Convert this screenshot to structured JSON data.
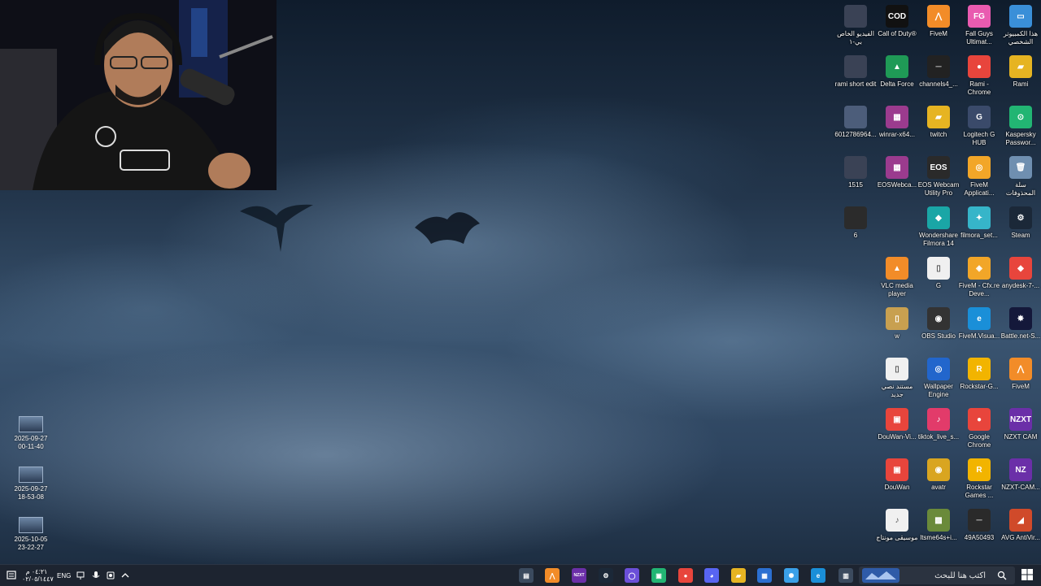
{
  "desktop": {
    "icons": [
      {
        "label": "الفيديو الخاص بي-١",
        "color": "#3a4255",
        "glyph": ""
      },
      {
        "label": "Call of Duty®",
        "color": "#111111",
        "glyph": "COD"
      },
      {
        "label": "FiveM",
        "color": "#f28c28",
        "glyph": "⋀"
      },
      {
        "label": "Fall Guys Ultimat...",
        "color": "#e95bb0",
        "glyph": "FG"
      },
      {
        "label": "هذا الكمبيوتر الشخصي",
        "color": "#3a8fd8",
        "glyph": "▭"
      },
      {
        "label": "rami short edit",
        "color": "#3a4255",
        "glyph": ""
      },
      {
        "label": "Delta Force",
        "color": "#1f9a56",
        "glyph": "▲"
      },
      {
        "label": "channels4_...",
        "color": "#222222",
        "glyph": "─"
      },
      {
        "label": "Rami - Chrome",
        "color": "#e8453c",
        "glyph": "●"
      },
      {
        "label": "Rami",
        "color": "#e6b422",
        "glyph": "▰"
      },
      {
        "label": "6012786964...",
        "color": "#4c5d7a",
        "glyph": ""
      },
      {
        "label": "winrar-x64...",
        "color": "#9b3b8e",
        "glyph": "▦"
      },
      {
        "label": "twitch",
        "color": "#e6b422",
        "glyph": "▰"
      },
      {
        "label": "Logitech G HUB",
        "color": "#3a4a6a",
        "glyph": "G"
      },
      {
        "label": "Kaspersky Passwor...",
        "color": "#22b573",
        "glyph": "⊙"
      },
      {
        "label": "1515",
        "color": "#3a4255",
        "glyph": ""
      },
      {
        "label": "EOSWebca...",
        "color": "#9b3b8e",
        "glyph": "▦"
      },
      {
        "label": "EOS Webcam Utility Pro",
        "color": "#2a2a2a",
        "glyph": "EOS"
      },
      {
        "label": "FiveM Applicati...",
        "color": "#f2a628",
        "glyph": "◎"
      },
      {
        "label": "سلة المحذوفات",
        "color": "#6f8fb0",
        "glyph": "🗑"
      },
      {
        "label": "6",
        "color": "#2b2b2b",
        "glyph": ""
      },
      {
        "label": "Wondershare Filmora 14",
        "color": "#1aa6a6",
        "glyph": "◆"
      },
      {
        "label": "filmora_set...",
        "color": "#36b5c9",
        "glyph": "✦"
      },
      {
        "label": "Steam",
        "color": "#1b2838",
        "glyph": "⚙"
      },
      {
        "label": "VLC media player",
        "color": "#f28c28",
        "glyph": "▲"
      },
      {
        "label": "G",
        "color": "#f0f0f0",
        "glyph": "▯"
      },
      {
        "label": "FiveM - Cfx.re Deve...",
        "color": "#f2a628",
        "glyph": "◈"
      },
      {
        "label": "anydesk-7-...",
        "color": "#e8453c",
        "glyph": "◆"
      },
      {
        "label": "w",
        "color": "#c8a050",
        "glyph": "▯"
      },
      {
        "label": "OBS Studio",
        "color": "#333333",
        "glyph": "◉"
      },
      {
        "label": "FiveM.Visua...",
        "color": "#1a8fd8",
        "glyph": "e"
      },
      {
        "label": "Battle.net-S...",
        "color": "#14183a",
        "glyph": "✸"
      },
      {
        "label": "مستند نصي جديد",
        "color": "#f0f0f0",
        "glyph": "▯"
      },
      {
        "label": "Wallpaper Engine",
        "color": "#2266cc",
        "glyph": "◎"
      },
      {
        "label": "Rockstar-G...",
        "color": "#f2b400",
        "glyph": "R"
      },
      {
        "label": "FiveM",
        "color": "#f28c28",
        "glyph": "⋀"
      },
      {
        "label": "DouWan-Vi...",
        "color": "#e8453c",
        "glyph": "▣"
      },
      {
        "label": "tiktok_live_s...",
        "color": "#e23b6a",
        "glyph": "♪"
      },
      {
        "label": "Google Chrome",
        "color": "#e8453c",
        "glyph": "●"
      },
      {
        "label": "NZXT CAM",
        "color": "#6b2fa8",
        "glyph": "NZXT"
      },
      {
        "label": "DouWan",
        "color": "#e8453c",
        "glyph": "▣"
      },
      {
        "label": "avatr",
        "color": "#d9a520",
        "glyph": "◉"
      },
      {
        "label": "Rockstar Games ...",
        "color": "#f2b400",
        "glyph": "R"
      },
      {
        "label": "NZXT-CAM...",
        "color": "#6b2fa8",
        "glyph": "NZ"
      },
      {
        "label": "موسيقى مونتاج",
        "color": "#f0f0f0",
        "glyph": "♪"
      },
      {
        "label": "ltsme64s+i...",
        "color": "#6a8a3a",
        "glyph": "▩"
      },
      {
        "label": "49A50493",
        "color": "#2a2a2a",
        "glyph": "─"
      },
      {
        "label": "AVG AntiVir...",
        "color": "#d04a2a",
        "glyph": "◢"
      }
    ],
    "left_icons": [
      {
        "date": "2025-09-27",
        "time": "00-11-40"
      },
      {
        "date": "2025-09-27",
        "time": "18-53-08"
      },
      {
        "date": "2025-10-05",
        "time": "23-22-27"
      }
    ]
  },
  "taskbar": {
    "clock_time": "٠٤:٢١ م",
    "clock_date": "٠٢/٠٥/١٤٤٧",
    "lang": "ENG",
    "search_placeholder": "اكتب هنا للبحث",
    "apps": [
      {
        "name": "widgets-icon",
        "color": "#3b4a5e",
        "glyph": "▤"
      },
      {
        "name": "fivem-taskbar-icon",
        "color": "#f28c28",
        "glyph": "⋀"
      },
      {
        "name": "nzxt-taskbar-icon",
        "color": "#6b2fa8",
        "glyph": "NZXT"
      },
      {
        "name": "steam-taskbar-icon",
        "color": "#1b2838",
        "glyph": "⚙"
      },
      {
        "name": "obs-taskbar-icon",
        "color": "#6b4fd8",
        "glyph": "◯"
      },
      {
        "name": "app-taskbar-icon",
        "color": "#22b573",
        "glyph": "▣"
      },
      {
        "name": "chrome-taskbar-icon",
        "color": "#e8453c",
        "glyph": "●"
      },
      {
        "name": "discord-taskbar-icon",
        "color": "#5865f2",
        "glyph": "◕"
      },
      {
        "name": "file-explorer-icon",
        "color": "#e6b422",
        "glyph": "▰"
      },
      {
        "name": "store-icon",
        "color": "#2b6fd1",
        "glyph": "▦"
      },
      {
        "name": "copilot-icon",
        "color": "#3aa0e8",
        "glyph": "✺"
      },
      {
        "name": "edge-icon",
        "color": "#1a8fd8",
        "glyph": "e"
      },
      {
        "name": "task-view-icon",
        "color": "#3b4a5e",
        "glyph": "▥"
      }
    ]
  }
}
